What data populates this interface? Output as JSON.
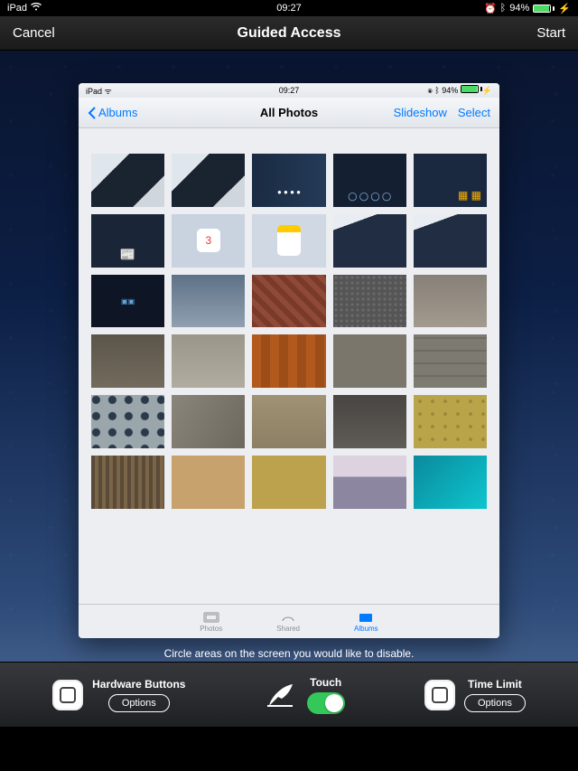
{
  "status_outer": {
    "device": "iPad",
    "time": "09:27",
    "battery": "94%"
  },
  "ga": {
    "cancel": "Cancel",
    "title": "Guided Access",
    "start": "Start"
  },
  "status_inner": {
    "device": "iPad",
    "time": "09:27",
    "battery": "94%"
  },
  "photos_nav": {
    "back": "Albums",
    "title": "All Photos",
    "slideshow": "Slideshow",
    "select": "Select"
  },
  "tabs": {
    "photos": "Photos",
    "shared": "Shared",
    "albums": "Albums"
  },
  "hint": "Circle areas on the screen you would like to disable.",
  "bottom": {
    "hw": "Hardware Buttons",
    "options": "Options",
    "touch": "Touch",
    "time": "Time Limit"
  },
  "chart_data": null
}
